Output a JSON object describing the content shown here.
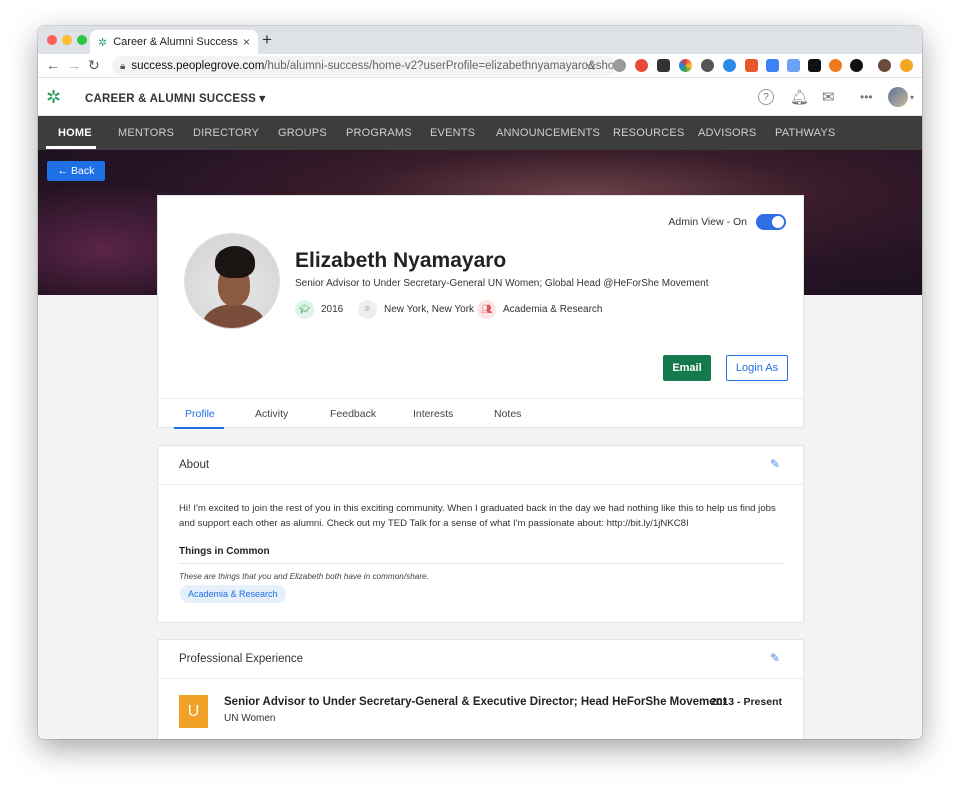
{
  "browser": {
    "tab_title": "Career & Alumni Success",
    "tab_close": "×",
    "new_tab": "+",
    "url_domain": "success.peoplegrove.com",
    "url_path": "/hub/alumni-success/home-v2?userProfile=elizabethnyamayaro&show..."
  },
  "app": {
    "name": "CAREER & ALUMNI SUCCESS ▾"
  },
  "nav": {
    "items": [
      "HOME",
      "MENTORS",
      "DIRECTORY",
      "GROUPS",
      "PROGRAMS",
      "EVENTS",
      "ANNOUNCEMENTS",
      "RESOURCES",
      "ADVISORS",
      "PATHWAYS"
    ],
    "active": "HOME"
  },
  "back_label": "← Back",
  "profile": {
    "admin_view_label": "Admin View - On",
    "name": "Elizabeth Nyamayaro",
    "headline": "Senior Advisor to Under Secretary-General UN Women; Global Head @HeForShe Movement",
    "year": "2016",
    "location": "New York, New York",
    "industry": "Academia & Research",
    "email_button": "Email",
    "login_as_button": "Login As",
    "tabs": [
      "Profile",
      "Activity",
      "Feedback",
      "Interests",
      "Notes"
    ],
    "active_tab": "Profile"
  },
  "about": {
    "title": "About",
    "text": "Hi! I'm excited to join the rest of you in this exciting community. When I graduated back in the day we had nothing like this to help us find jobs and support each other as alumni. Check out my TED Talk for a sense of what I'm passionate about: http://bit.ly/1jNKC8I",
    "common_title": "Things in Common",
    "common_note": "These are things that you and Elizabeth both have in common/share.",
    "common_chip": "Academia & Research"
  },
  "experience": {
    "title": "Professional Experience",
    "logo_letter": "U",
    "role": "Senior Advisor to Under Secretary-General & Executive Director; Head HeForShe Movement",
    "org": "UN Women",
    "dates": "2013 - Present"
  },
  "colors": {
    "accent_blue": "#1f6fe5",
    "email_green": "#147a4d",
    "nav_bg": "#3d3d3d",
    "logo_orange": "#f1a126"
  }
}
